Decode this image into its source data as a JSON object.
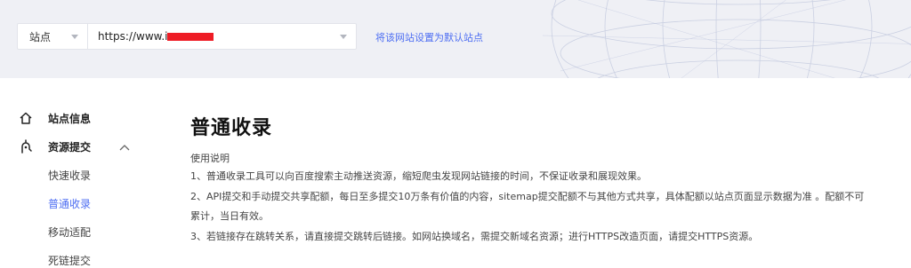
{
  "header": {
    "site_type_label": "站点",
    "site_url": "https://www.i",
    "set_default_link": "将该网站设置为默认站点"
  },
  "sidebar": {
    "items": [
      {
        "label": "站点信息",
        "icon": "home-icon"
      },
      {
        "label": "资源提交",
        "icon": "submit-icon",
        "expanded": true
      }
    ],
    "sub_items": [
      {
        "label": "快速收录",
        "active": false
      },
      {
        "label": "普通收录",
        "active": true
      },
      {
        "label": "移动适配",
        "active": false
      },
      {
        "label": "死链提交",
        "active": false
      }
    ]
  },
  "main": {
    "title": "普通收录",
    "intro": "使用说明",
    "notes": [
      "1、普通收录工具可以向百度搜索主动推送资源，缩短爬虫发现网站链接的时间，不保证收录和展现效果。",
      "2、API提交和手动提交共享配额，每日至多提交10万条有价值的内容，sitemap提交配额不与其他方式共享，具体配额以站点页面显示数据为准 。配额不可",
      "累计，当日有效。",
      "3、若链接存在跳转关系，请直接提交跳转后链接。如网站换域名，需提交新域名资源；进行HTTPS改造页面，请提交HTTPS资源。"
    ]
  },
  "colors": {
    "accent": "#4e6ef2",
    "header_bg": "#eff0f5",
    "redaction": "#ee1c25"
  }
}
